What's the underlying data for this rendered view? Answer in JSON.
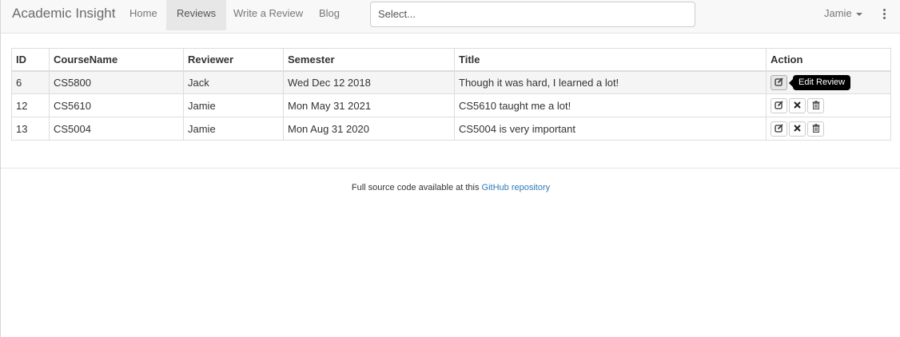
{
  "navbar": {
    "brand": "Academic Insight",
    "items": [
      {
        "label": "Home",
        "active": false
      },
      {
        "label": "Reviews",
        "active": true
      },
      {
        "label": "Write a Review",
        "active": false
      },
      {
        "label": "Blog",
        "active": false
      }
    ],
    "select_placeholder": "Select...",
    "user": "Jamie"
  },
  "table": {
    "headers": [
      "ID",
      "CourseName",
      "Reviewer",
      "Semester",
      "Title",
      "Action"
    ],
    "rows": [
      {
        "id": "6",
        "course": "CS5800",
        "reviewer": "Jack",
        "semester": "Wed Dec 12 2018",
        "title": "Though it was hard, I learned a lot!"
      },
      {
        "id": "12",
        "course": "CS5610",
        "reviewer": "Jamie",
        "semester": "Mon May 31 2021",
        "title": "CS5610 taught me a lot!"
      },
      {
        "id": "13",
        "course": "CS5004",
        "reviewer": "Jamie",
        "semester": "Mon Aug 31 2020",
        "title": "CS5004 is very important"
      }
    ],
    "tooltip": "Edit Review"
  },
  "footer": {
    "text": "Full source code available at this",
    "link": "GitHub repository"
  },
  "colors": {
    "navbar_bg": "#f8f8f8",
    "link": "#337ab7",
    "tooltip_bg": "#000000"
  }
}
